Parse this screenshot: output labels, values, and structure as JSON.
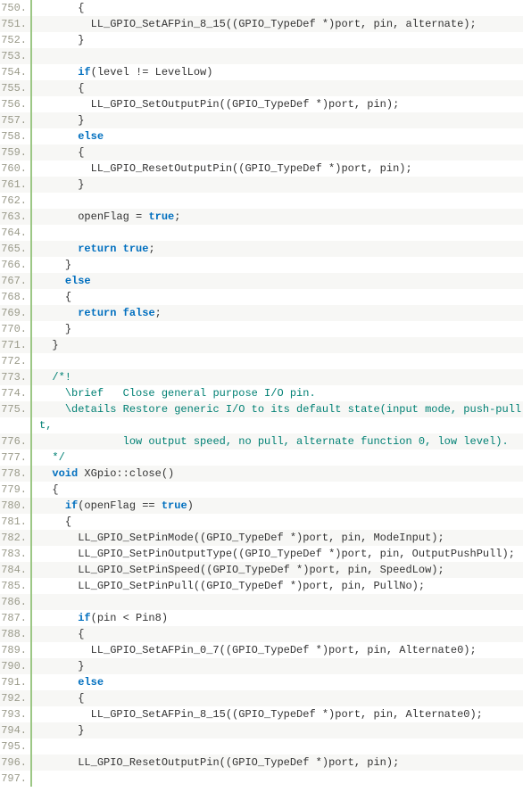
{
  "lines": [
    {
      "num": "750.",
      "indent": 3,
      "tokens": [
        {
          "t": "{",
          "c": ""
        }
      ]
    },
    {
      "num": "751.",
      "indent": 4,
      "tokens": [
        {
          "t": "LL_GPIO_SetAFPin_8_15((GPIO_TypeDef *)port, pin, alternate);",
          "c": ""
        }
      ]
    },
    {
      "num": "752.",
      "indent": 3,
      "tokens": [
        {
          "t": "}",
          "c": ""
        }
      ]
    },
    {
      "num": "753.",
      "indent": 0,
      "tokens": []
    },
    {
      "num": "754.",
      "indent": 3,
      "tokens": [
        {
          "t": "if",
          "c": "kw"
        },
        {
          "t": "(level != LevelLow)",
          "c": ""
        }
      ]
    },
    {
      "num": "755.",
      "indent": 3,
      "tokens": [
        {
          "t": "{",
          "c": ""
        }
      ]
    },
    {
      "num": "756.",
      "indent": 4,
      "tokens": [
        {
          "t": "LL_GPIO_SetOutputPin((GPIO_TypeDef *)port, pin);",
          "c": ""
        }
      ]
    },
    {
      "num": "757.",
      "indent": 3,
      "tokens": [
        {
          "t": "}",
          "c": ""
        }
      ]
    },
    {
      "num": "758.",
      "indent": 3,
      "tokens": [
        {
          "t": "else",
          "c": "kw"
        }
      ]
    },
    {
      "num": "759.",
      "indent": 3,
      "tokens": [
        {
          "t": "{",
          "c": ""
        }
      ]
    },
    {
      "num": "760.",
      "indent": 4,
      "tokens": [
        {
          "t": "LL_GPIO_ResetOutputPin((GPIO_TypeDef *)port, pin);",
          "c": ""
        }
      ]
    },
    {
      "num": "761.",
      "indent": 3,
      "tokens": [
        {
          "t": "}",
          "c": ""
        }
      ]
    },
    {
      "num": "762.",
      "indent": 0,
      "tokens": []
    },
    {
      "num": "763.",
      "indent": 3,
      "tokens": [
        {
          "t": "openFlag = ",
          "c": ""
        },
        {
          "t": "true",
          "c": "kw"
        },
        {
          "t": ";",
          "c": ""
        }
      ]
    },
    {
      "num": "764.",
      "indent": 0,
      "tokens": []
    },
    {
      "num": "765.",
      "indent": 3,
      "tokens": [
        {
          "t": "return",
          "c": "kw"
        },
        {
          "t": " ",
          "c": ""
        },
        {
          "t": "true",
          "c": "kw"
        },
        {
          "t": ";",
          "c": ""
        }
      ]
    },
    {
      "num": "766.",
      "indent": 2,
      "tokens": [
        {
          "t": "}",
          "c": ""
        }
      ]
    },
    {
      "num": "767.",
      "indent": 2,
      "tokens": [
        {
          "t": "else",
          "c": "kw"
        }
      ]
    },
    {
      "num": "768.",
      "indent": 2,
      "tokens": [
        {
          "t": "{",
          "c": ""
        }
      ]
    },
    {
      "num": "769.",
      "indent": 3,
      "tokens": [
        {
          "t": "return",
          "c": "kw"
        },
        {
          "t": " ",
          "c": ""
        },
        {
          "t": "false",
          "c": "kw"
        },
        {
          "t": ";",
          "c": ""
        }
      ]
    },
    {
      "num": "770.",
      "indent": 2,
      "tokens": [
        {
          "t": "}",
          "c": ""
        }
      ]
    },
    {
      "num": "771.",
      "indent": 1,
      "tokens": [
        {
          "t": "}",
          "c": ""
        }
      ]
    },
    {
      "num": "772.",
      "indent": 0,
      "tokens": []
    },
    {
      "num": "773.",
      "indent": 1,
      "tokens": [
        {
          "t": "/*!",
          "c": "cmt"
        }
      ]
    },
    {
      "num": "774.",
      "indent": 2,
      "tokens": [
        {
          "t": "\\brief   Close general purpose I/O pin.",
          "c": "cmt"
        }
      ]
    },
    {
      "num": "775.",
      "indent": 2,
      "tokens": [
        {
          "t": "\\details Restore generic I/O to its default state(input mode, push-pull outpu",
          "c": "cmt"
        }
      ],
      "wrap": [
        {
          "t": "t,",
          "c": "cmt"
        }
      ]
    },
    {
      "num": "776.",
      "indent": 6,
      "tokens": [
        {
          "t": " low output speed, no pull, alternate function 0, low level).",
          "c": "cmt"
        }
      ]
    },
    {
      "num": "777.",
      "indent": 1,
      "tokens": [
        {
          "t": "*/",
          "c": "cmt"
        }
      ]
    },
    {
      "num": "778.",
      "indent": 1,
      "tokens": [
        {
          "t": "void",
          "c": "kw"
        },
        {
          "t": " XGpio::close()",
          "c": ""
        }
      ]
    },
    {
      "num": "779.",
      "indent": 1,
      "tokens": [
        {
          "t": "{",
          "c": ""
        }
      ]
    },
    {
      "num": "780.",
      "indent": 2,
      "tokens": [
        {
          "t": "if",
          "c": "kw"
        },
        {
          "t": "(openFlag == ",
          "c": ""
        },
        {
          "t": "true",
          "c": "kw"
        },
        {
          "t": ")",
          "c": ""
        }
      ]
    },
    {
      "num": "781.",
      "indent": 2,
      "tokens": [
        {
          "t": "{",
          "c": ""
        }
      ]
    },
    {
      "num": "782.",
      "indent": 3,
      "tokens": [
        {
          "t": "LL_GPIO_SetPinMode((GPIO_TypeDef *)port, pin, ModeInput);",
          "c": ""
        }
      ]
    },
    {
      "num": "783.",
      "indent": 3,
      "tokens": [
        {
          "t": "LL_GPIO_SetPinOutputType((GPIO_TypeDef *)port, pin, OutputPushPull);",
          "c": ""
        }
      ]
    },
    {
      "num": "784.",
      "indent": 3,
      "tokens": [
        {
          "t": "LL_GPIO_SetPinSpeed((GPIO_TypeDef *)port, pin, SpeedLow);",
          "c": ""
        }
      ]
    },
    {
      "num": "785.",
      "indent": 3,
      "tokens": [
        {
          "t": "LL_GPIO_SetPinPull((GPIO_TypeDef *)port, pin, PullNo);",
          "c": ""
        }
      ]
    },
    {
      "num": "786.",
      "indent": 0,
      "tokens": []
    },
    {
      "num": "787.",
      "indent": 3,
      "tokens": [
        {
          "t": "if",
          "c": "kw"
        },
        {
          "t": "(pin < Pin8)",
          "c": ""
        }
      ]
    },
    {
      "num": "788.",
      "indent": 3,
      "tokens": [
        {
          "t": "{",
          "c": ""
        }
      ]
    },
    {
      "num": "789.",
      "indent": 4,
      "tokens": [
        {
          "t": "LL_GPIO_SetAFPin_0_7((GPIO_TypeDef *)port, pin, Alternate0);",
          "c": ""
        }
      ]
    },
    {
      "num": "790.",
      "indent": 3,
      "tokens": [
        {
          "t": "}",
          "c": ""
        }
      ]
    },
    {
      "num": "791.",
      "indent": 3,
      "tokens": [
        {
          "t": "else",
          "c": "kw"
        }
      ]
    },
    {
      "num": "792.",
      "indent": 3,
      "tokens": [
        {
          "t": "{",
          "c": ""
        }
      ]
    },
    {
      "num": "793.",
      "indent": 4,
      "tokens": [
        {
          "t": "LL_GPIO_SetAFPin_8_15((GPIO_TypeDef *)port, pin, Alternate0);",
          "c": ""
        }
      ]
    },
    {
      "num": "794.",
      "indent": 3,
      "tokens": [
        {
          "t": "}",
          "c": ""
        }
      ]
    },
    {
      "num": "795.",
      "indent": 0,
      "tokens": []
    },
    {
      "num": "796.",
      "indent": 3,
      "tokens": [
        {
          "t": "LL_GPIO_ResetOutputPin((GPIO_TypeDef *)port, pin);",
          "c": ""
        }
      ]
    },
    {
      "num": "797.",
      "indent": 0,
      "tokens": []
    }
  ]
}
